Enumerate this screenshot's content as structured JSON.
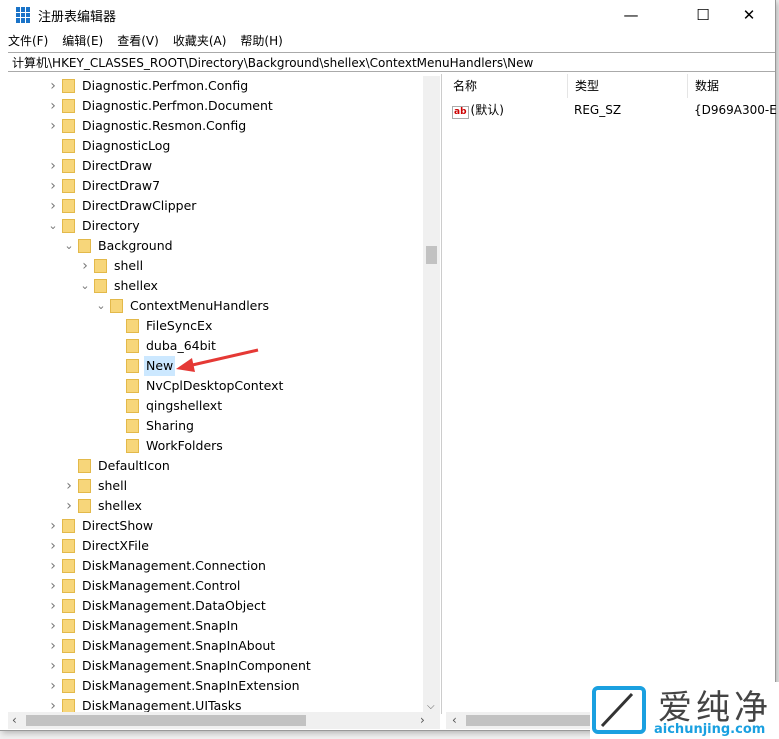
{
  "window": {
    "title": "注册表编辑器",
    "minimize": "—",
    "maximize": "☐",
    "close": "✕"
  },
  "menu": [
    "文件(F)",
    "编辑(E)",
    "查看(V)",
    "收藏夹(A)",
    "帮助(H)"
  ],
  "address": "计算机\\HKEY_CLASSES_ROOT\\Directory\\Background\\shellex\\ContextMenuHandlers\\New",
  "tree": [
    {
      "label": "Diagnostic.Perfmon.Config",
      "level": 0,
      "state": "collapsed"
    },
    {
      "label": "Diagnostic.Perfmon.Document",
      "level": 0,
      "state": "collapsed"
    },
    {
      "label": "Diagnostic.Resmon.Config",
      "level": 0,
      "state": "collapsed"
    },
    {
      "label": "DiagnosticLog",
      "level": 0,
      "state": "none"
    },
    {
      "label": "DirectDraw",
      "level": 0,
      "state": "collapsed"
    },
    {
      "label": "DirectDraw7",
      "level": 0,
      "state": "collapsed"
    },
    {
      "label": "DirectDrawClipper",
      "level": 0,
      "state": "collapsed"
    },
    {
      "label": "Directory",
      "level": 0,
      "state": "expanded"
    },
    {
      "label": "Background",
      "level": 1,
      "state": "expanded"
    },
    {
      "label": "shell",
      "level": 2,
      "state": "collapsed"
    },
    {
      "label": "shellex",
      "level": 2,
      "state": "expanded"
    },
    {
      "label": "ContextMenuHandlers",
      "level": 3,
      "state": "expanded"
    },
    {
      "label": "FileSyncEx",
      "level": 4,
      "state": "none"
    },
    {
      "label": "duba_64bit",
      "level": 4,
      "state": "none"
    },
    {
      "label": "New",
      "level": 4,
      "state": "none",
      "selected": true
    },
    {
      "label": "NvCplDesktopContext",
      "level": 4,
      "state": "none"
    },
    {
      "label": "qingshellext",
      "level": 4,
      "state": "none"
    },
    {
      "label": "Sharing",
      "level": 4,
      "state": "none"
    },
    {
      "label": "WorkFolders",
      "level": 4,
      "state": "none"
    },
    {
      "label": "DefaultIcon",
      "level": 1,
      "state": "none"
    },
    {
      "label": "shell",
      "level": 1,
      "state": "collapsed"
    },
    {
      "label": "shellex",
      "level": 1,
      "state": "collapsed"
    },
    {
      "label": "DirectShow",
      "level": 0,
      "state": "collapsed"
    },
    {
      "label": "DirectXFile",
      "level": 0,
      "state": "collapsed"
    },
    {
      "label": "DiskManagement.Connection",
      "level": 0,
      "state": "collapsed"
    },
    {
      "label": "DiskManagement.Control",
      "level": 0,
      "state": "collapsed"
    },
    {
      "label": "DiskManagement.DataObject",
      "level": 0,
      "state": "collapsed"
    },
    {
      "label": "DiskManagement.SnapIn",
      "level": 0,
      "state": "collapsed"
    },
    {
      "label": "DiskManagement.SnapInAbout",
      "level": 0,
      "state": "collapsed"
    },
    {
      "label": "DiskManagement.SnapInComponent",
      "level": 0,
      "state": "collapsed"
    },
    {
      "label": "DiskManagement.SnapInExtension",
      "level": 0,
      "state": "collapsed"
    },
    {
      "label": "DiskManagement.UITasks",
      "level": 0,
      "state": "collapsed"
    }
  ],
  "columns": [
    "名称",
    "类型",
    "数据"
  ],
  "values": [
    {
      "name": "(默认)",
      "icon": "ab",
      "type": "REG_SZ",
      "data": "{D969A300-E"
    }
  ],
  "watermark": {
    "brand": "爱纯净",
    "url": "aichunjing.com"
  },
  "colors": {
    "selection": "#cce8ff",
    "folder": "#f7d67a",
    "arrow": "#e53935",
    "brand": "#1aa0e0"
  }
}
